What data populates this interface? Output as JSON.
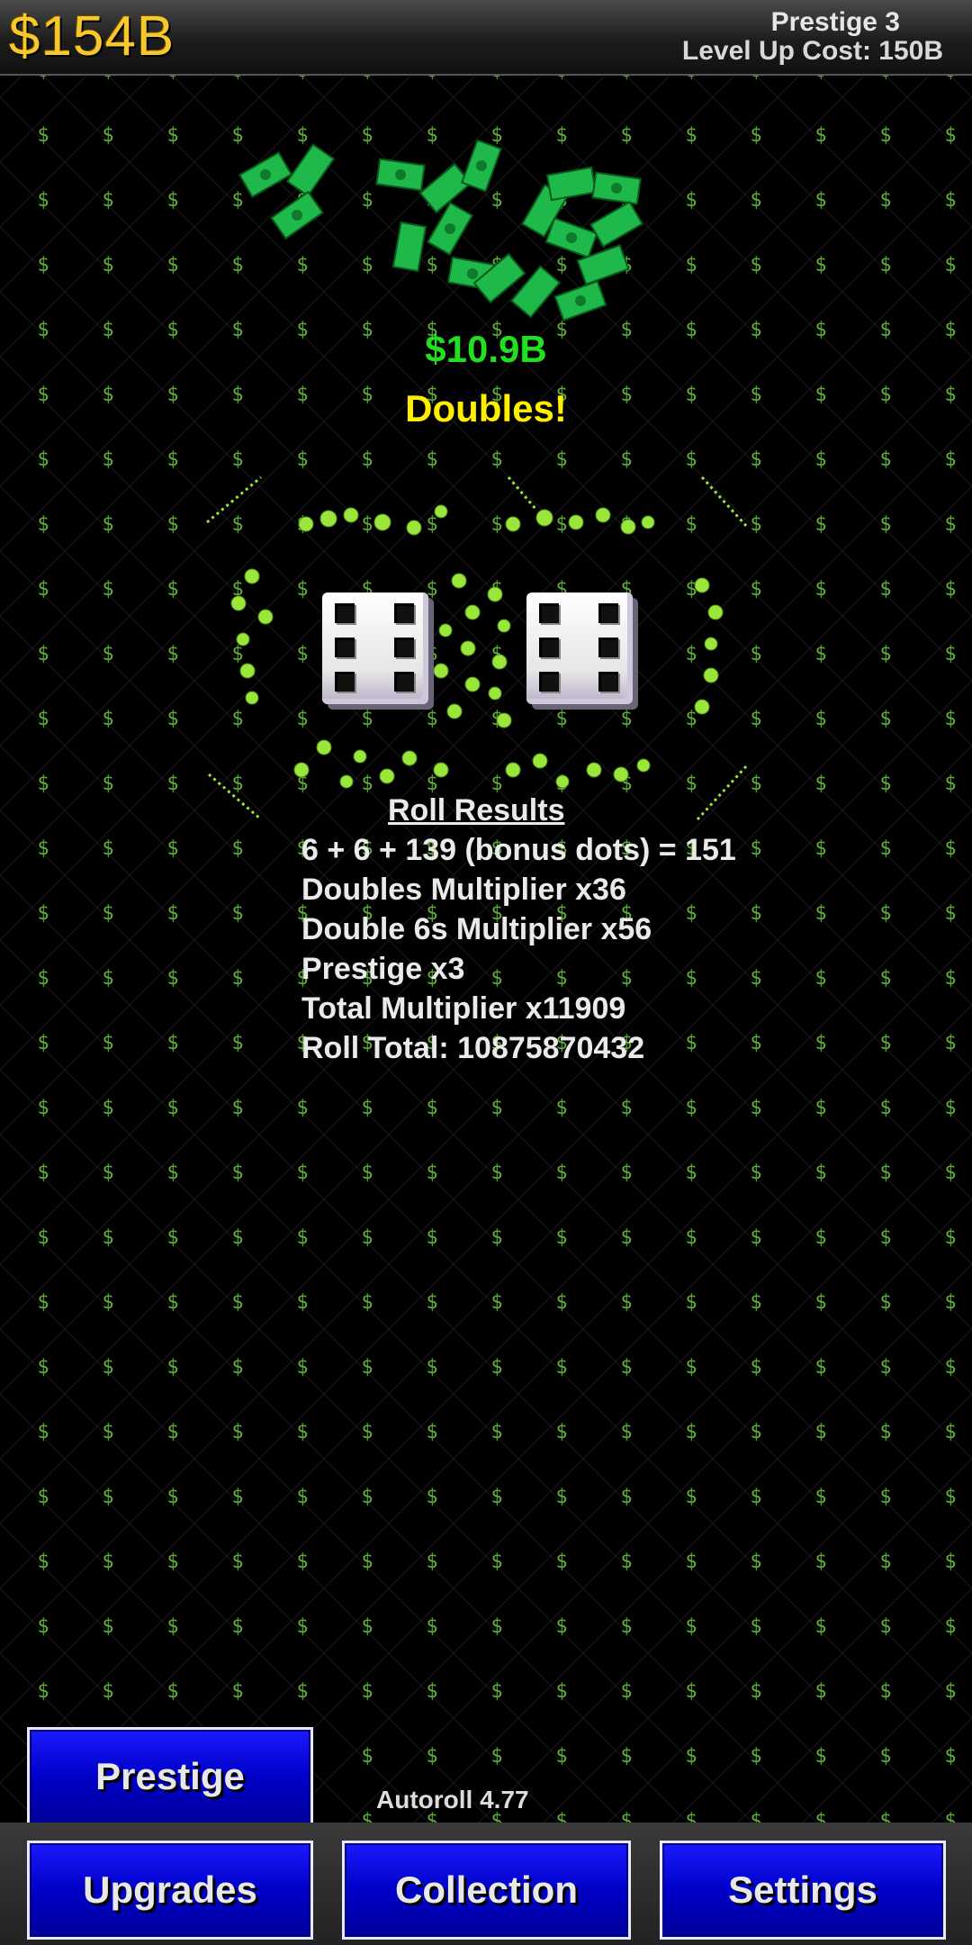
{
  "header": {
    "money": "$154B",
    "prestige": "Prestige 3",
    "level_up_cost": "Level Up Cost: 150B"
  },
  "roll": {
    "gain": "$10.9B",
    "banner": "Doubles!",
    "dice_values": [
      6,
      6
    ]
  },
  "results": {
    "heading": "Roll Results",
    "lines": [
      "6 + 6 + 139 (bonus dots) = 151",
      "Doubles Multiplier x36",
      "Double 6s Multiplier x56",
      "Prestige x3",
      "Total Multiplier x11909",
      "Roll Total: 10875870432"
    ]
  },
  "autoroll": "Autoroll 4.77",
  "buttons": {
    "prestige": "Prestige",
    "upgrades": "Upgrades",
    "collection": "Collection",
    "settings": "Settings"
  },
  "colors": {
    "money": "#f7c82c",
    "gain": "#20e020",
    "banner": "#ffee00",
    "dollar_symbol": "#5fae3a",
    "button": "#0000c8"
  },
  "background_symbol": "$"
}
